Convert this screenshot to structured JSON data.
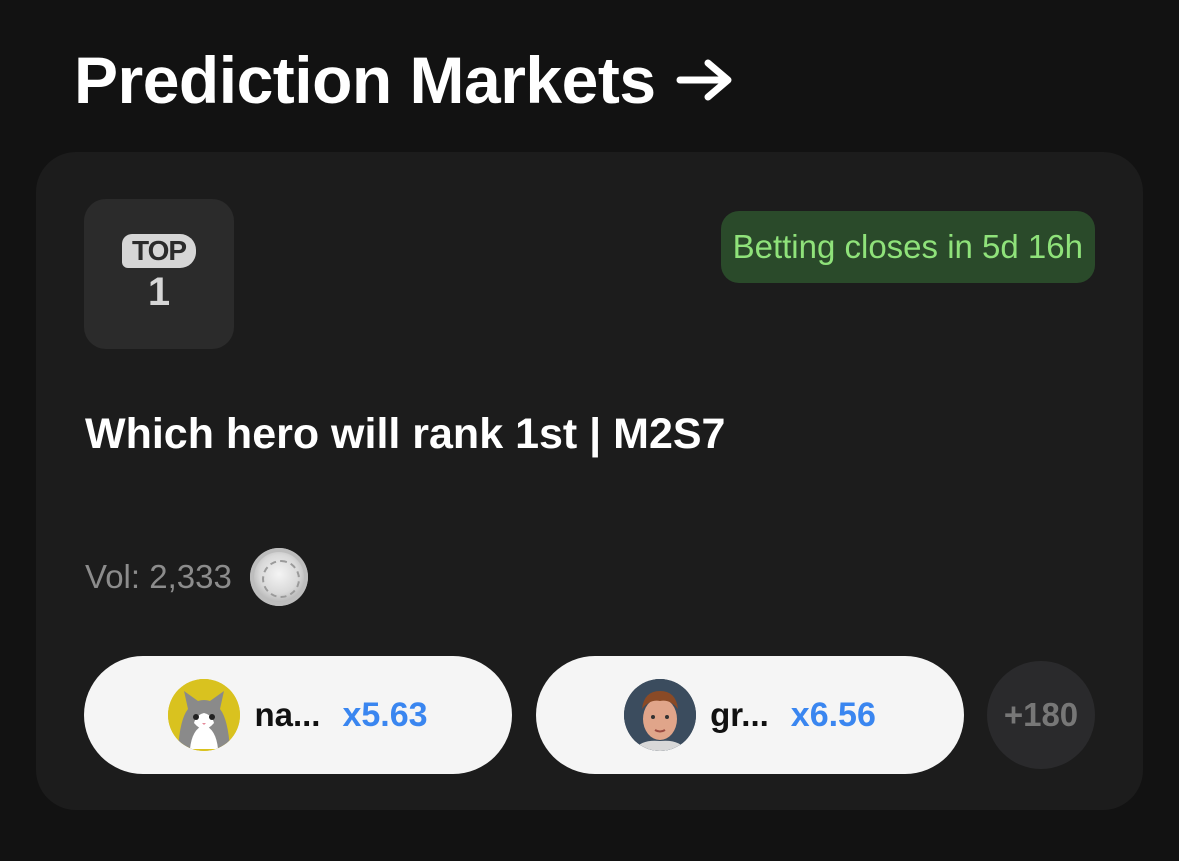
{
  "header": {
    "title": "Prediction Markets"
  },
  "market": {
    "logo_top": "TOP",
    "logo_rank": "1",
    "status": "Betting closes in 5d 16h",
    "title": "Which hero will rank 1st | M2S7",
    "volume": "Vol: 2,333"
  },
  "options": [
    {
      "name": "na...",
      "odds": "x5.63",
      "avatar": "cat-avatar"
    },
    {
      "name": "gr...",
      "odds": "x6.56",
      "avatar": "person-avatar"
    }
  ],
  "more": "+180",
  "colors": {
    "background": "#121212",
    "card": "#1c1c1c",
    "status_bg": "#2a4a2a",
    "status_text": "#8fe27a",
    "odds": "#3a86f0"
  },
  "icons": [
    "arrow-right-icon",
    "top-1-logo-icon",
    "silver-coin-icon"
  ]
}
